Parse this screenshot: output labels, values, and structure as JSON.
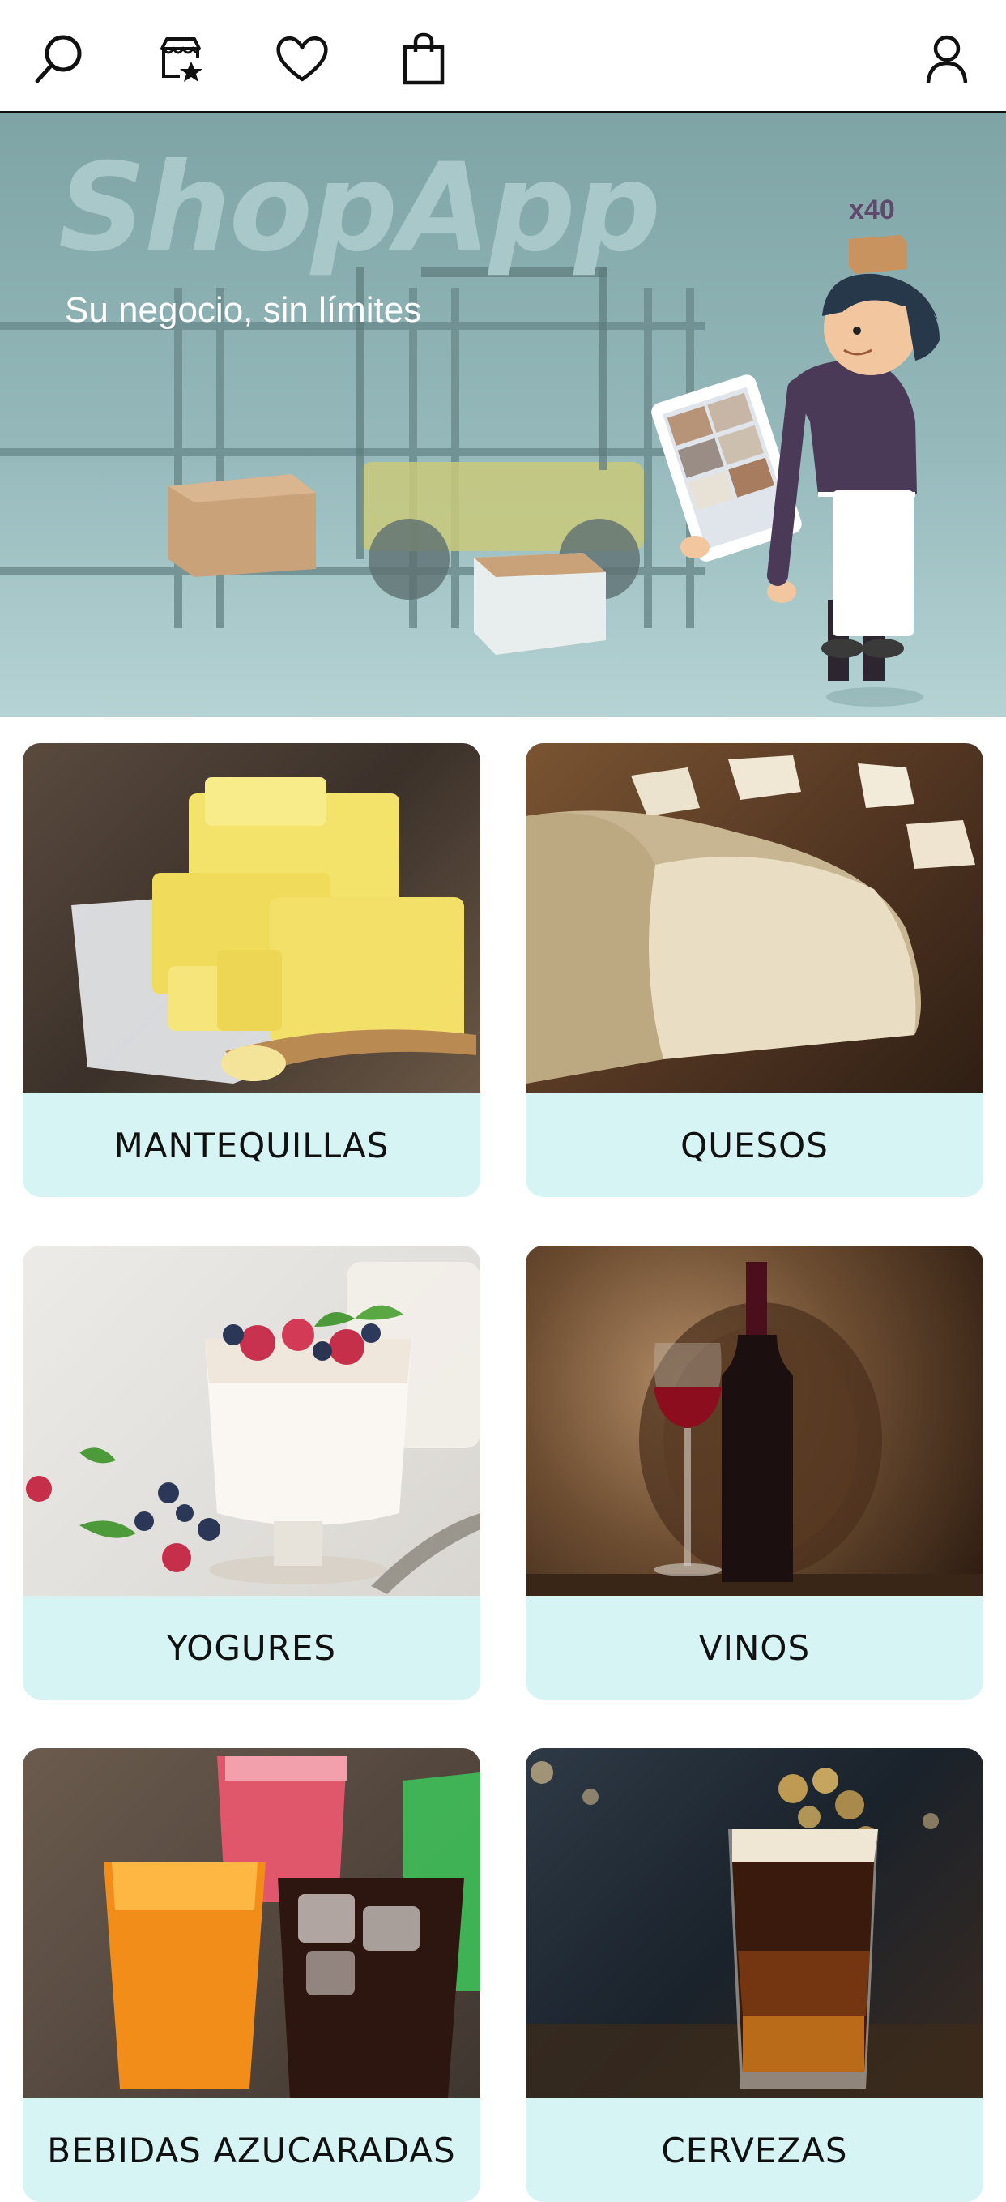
{
  "toolbar": {
    "icons": [
      "search-icon",
      "favorite-stores-icon",
      "heart-icon",
      "shopping-bag-icon",
      "user-icon"
    ]
  },
  "banner": {
    "brand": "ShopApp",
    "tagline": "Su negocio, sin límites",
    "box_count": "x40"
  },
  "categories": [
    {
      "label": "MANTEQUILLAS"
    },
    {
      "label": "QUESOS"
    },
    {
      "label": "YOGURES"
    },
    {
      "label": "VINOS"
    },
    {
      "label": "BEBIDAS AZUCARADAS"
    },
    {
      "label": "CERVEZAS"
    }
  ]
}
